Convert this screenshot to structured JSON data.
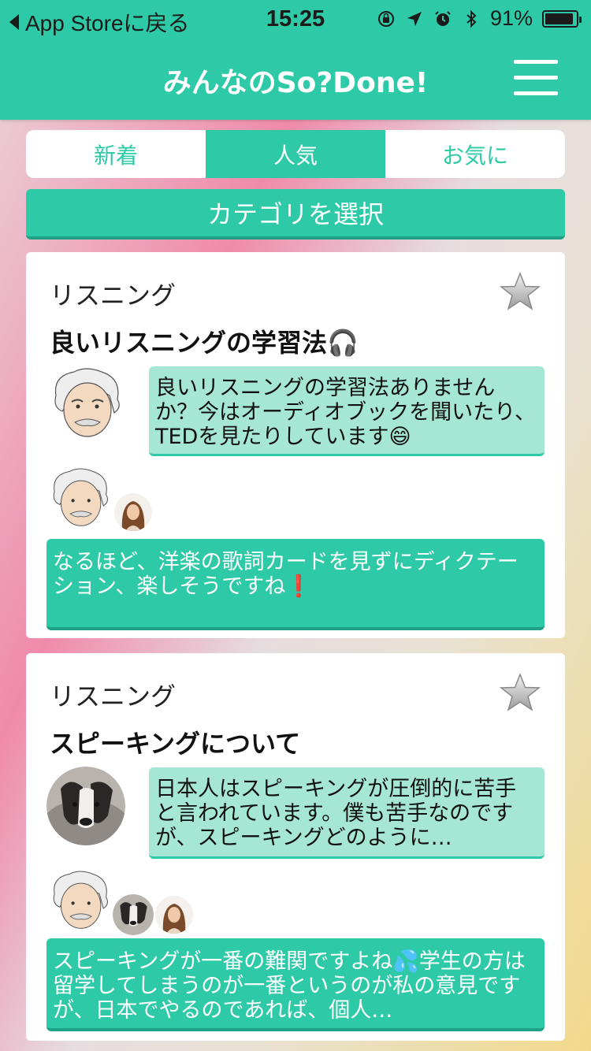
{
  "status_bar": {
    "back_label": "App Storeに戻る",
    "time": "15:25",
    "battery": "91%",
    "battery_level": 0.91
  },
  "nav": {
    "title": "みんなのSo?Done!"
  },
  "tabs": [
    {
      "label": "新着",
      "active": false
    },
    {
      "label": "人気",
      "active": true
    },
    {
      "label": "お気に",
      "active": false
    }
  ],
  "category_button": {
    "label": "カテゴリを選択"
  },
  "posts": [
    {
      "category": "リスニング",
      "title": "良いリスニングの学習法🎧",
      "question": "良いリスニングの学習法ありませんか？今はオーディオブックを聞いたり、TEDを見たりしています😄",
      "answer": "なるほど、洋楽の歌詞カードを見ずにディクテーション、楽しそうですね❗️"
    },
    {
      "category": "リスニング",
      "title": "スピーキングについて",
      "question": "日本人はスピーキングが圧倒的に苦手と言われています。僕も苦手なのですが、スピーキングどのように…",
      "answer": "スピーキングが一番の難関ですよね💦学生の方は留学してしまうのが一番というのが私の意見ですが、日本でやるのであれば、個人…"
    }
  ],
  "colors": {
    "accent": "#2ec9a6",
    "bubble": "#a6e6d4"
  },
  "icons": [
    "back-triangle-icon",
    "orientation-lock-icon",
    "location-arrow-icon",
    "alarm-icon",
    "bluetooth-icon",
    "battery-icon",
    "hamburger-menu-icon",
    "star-icon"
  ]
}
